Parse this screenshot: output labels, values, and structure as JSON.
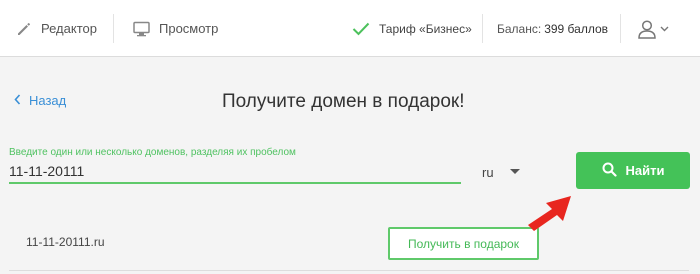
{
  "header": {
    "editor_label": "Редактор",
    "preview_label": "Просмотр",
    "tariff_label": "Тариф «Бизнес»",
    "balance_label": "Баланс:",
    "balance_value": "399 баллов"
  },
  "page": {
    "back_label": "Назад",
    "title": "Получите домен в подарок!"
  },
  "search": {
    "hint": "Введите один или несколько доменов, разделяя их пробелом",
    "value": "11-11-20111",
    "zone_selected": "ru",
    "find_label": "Найти"
  },
  "results": [
    {
      "domain": "11-11-20111.ru",
      "action_label": "Получить в подарок"
    }
  ],
  "colors": {
    "accent_green": "#44c258",
    "link_blue": "#3a8fd6",
    "arrow_red": "#e8261f"
  },
  "icons": [
    "pencil-icon",
    "monitor-icon",
    "check-icon",
    "user-icon",
    "chevron-down-icon",
    "chevron-left-icon",
    "search-icon",
    "red-arrow-pointer"
  ]
}
